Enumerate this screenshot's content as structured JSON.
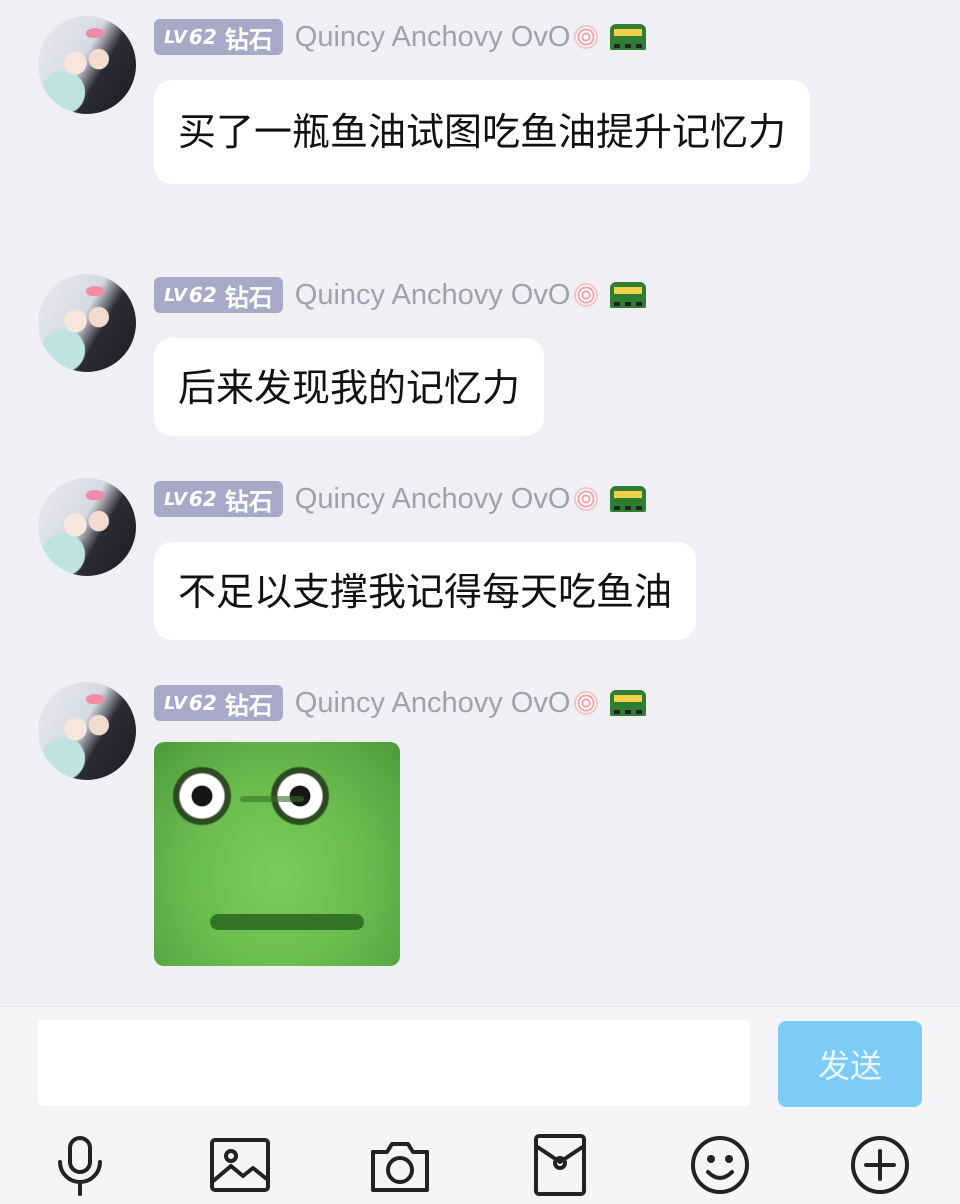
{
  "messages": [
    {
      "level_prefix": "LV",
      "level": "62",
      "tier": "钻石",
      "username": "Quincy Anchovy OvO",
      "text": "买了一瓶鱼油试图吃鱼油提升记忆力"
    },
    {
      "level_prefix": "LV",
      "level": "62",
      "tier": "钻石",
      "username": "Quincy Anchovy OvO",
      "text": "后来发现我的记忆力"
    },
    {
      "level_prefix": "LV",
      "level": "62",
      "tier": "钻石",
      "username": "Quincy Anchovy OvO",
      "text": "不足以支撑我记得每天吃鱼油"
    },
    {
      "level_prefix": "LV",
      "level": "62",
      "tier": "钻石",
      "username": "Quincy Anchovy OvO",
      "sticker": "frog-face-sticker"
    }
  ],
  "composer": {
    "input_value": "",
    "send_label": "发送"
  },
  "toolbar": {
    "icons": [
      "microphone-icon",
      "image-icon",
      "camera-icon",
      "red-packet-icon",
      "emoji-icon",
      "plus-icon"
    ]
  },
  "colors": {
    "background": "#efeff4",
    "bubble": "#ffffff",
    "level_badge": "#a7a9c7",
    "username": "#9fa1ae",
    "send_button": "#7ecbf7"
  }
}
